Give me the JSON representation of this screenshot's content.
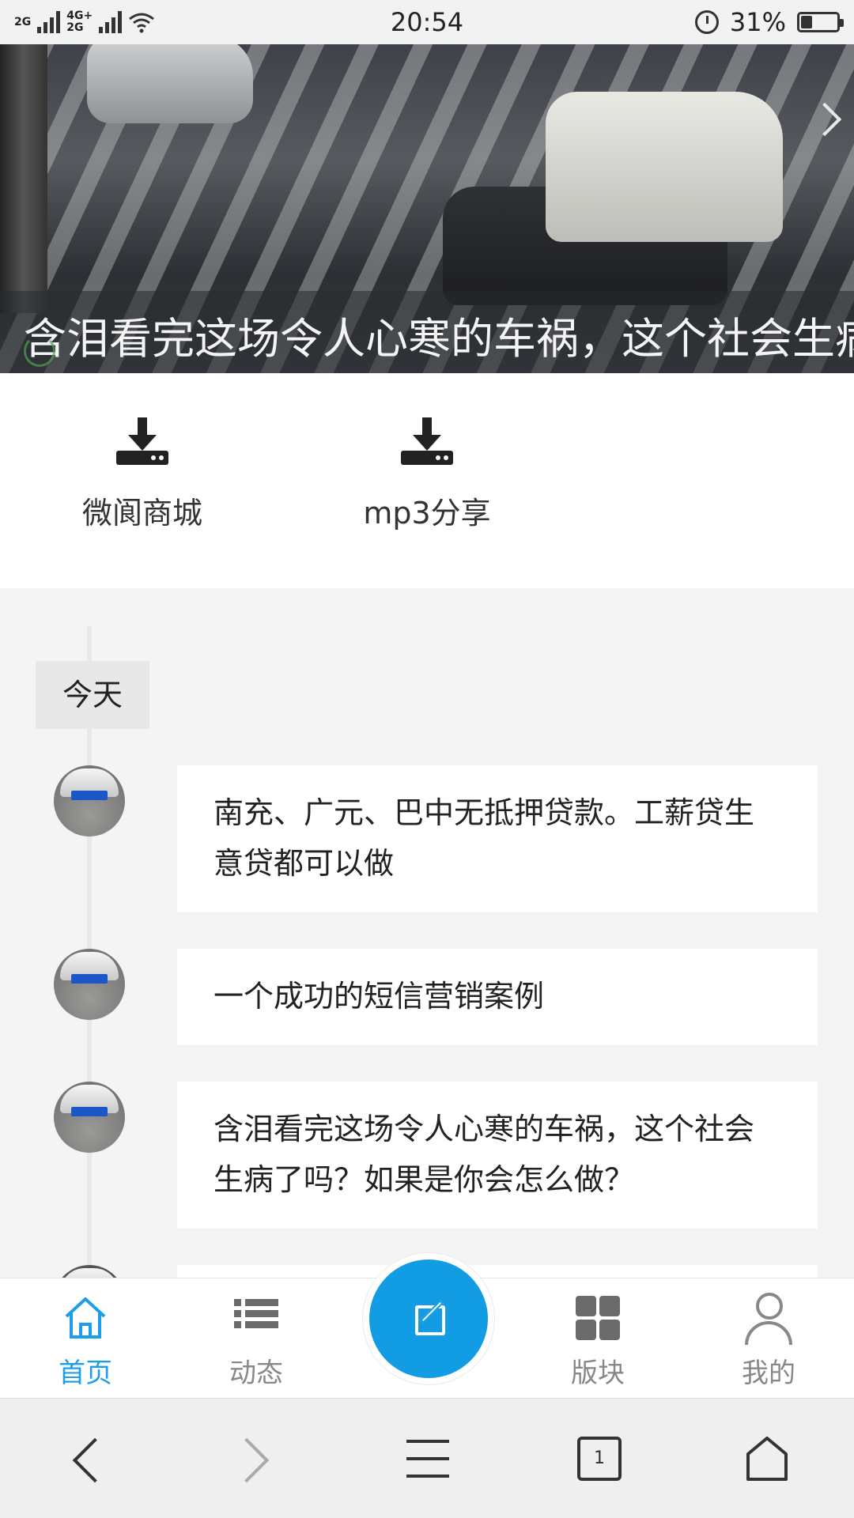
{
  "status_bar": {
    "network_1": "2G",
    "network_2_top": "4G+",
    "network_2_bottom": "2G",
    "time": "20:54",
    "battery": "31%",
    "battery_level": 0.31
  },
  "banner": {
    "caption": "含泪看完这场令人心寒的车祸，这个社会生病了吗？如果是你会怎么做？",
    "next_icon": "chevron-right-icon"
  },
  "quick_links": [
    {
      "label": "微阆商城",
      "icon": "download-icon"
    },
    {
      "label": "mp3分享",
      "icon": "download-icon"
    }
  ],
  "timeline": {
    "day_label": "今天",
    "posts": [
      {
        "text": "南充、广元、巴中无抵押贷款。工薪贷生意贷都可以做"
      },
      {
        "text": "一个成功的短信营销案例"
      },
      {
        "text": "含泪看完这场令人心寒的车祸，这个社会生病了吗？如果是你会怎么做？"
      }
    ]
  },
  "tab_bar": {
    "accent": "#1e9ee8",
    "compose_color": "#129ce3",
    "tabs": [
      {
        "label": "首页",
        "icon": "home-icon",
        "active": true
      },
      {
        "label": "动态",
        "icon": "list-icon",
        "active": false
      },
      {
        "label": "版块",
        "icon": "grid-icon",
        "active": false
      },
      {
        "label": "我的",
        "icon": "user-icon",
        "active": false
      }
    ],
    "compose_icon": "compose-icon"
  },
  "browser_bar": {
    "tab_count": "1",
    "icons": [
      "back-icon",
      "forward-icon",
      "menu-icon",
      "tabs-icon",
      "home-icon"
    ]
  }
}
